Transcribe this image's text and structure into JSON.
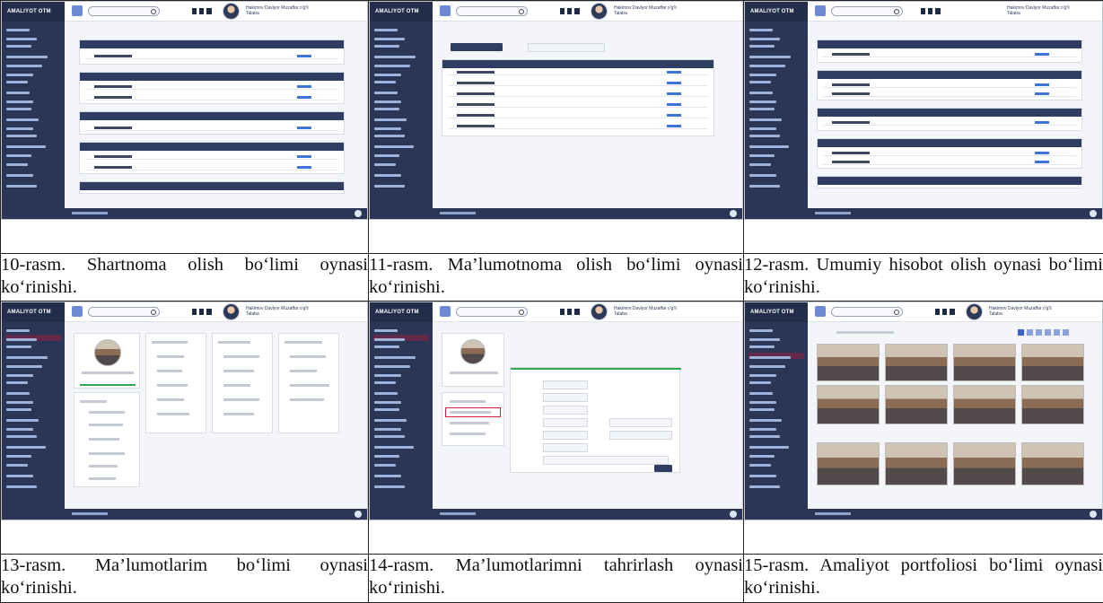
{
  "shared": {
    "brand": "AMALIYOT OTM",
    "user_name_line1": "Hakimov Davlyor Muzaffar o'g'li",
    "user_name_line2": "Talaba"
  },
  "captions": [
    {
      "title": "10-rasm.",
      "text": "Shartnoma olish bo‘limi oynasi ko‘rinishi."
    },
    {
      "title": "11-rasm.",
      "text": "Ma’lumotnoma olish bo‘limi oynasi ko‘rinishi."
    },
    {
      "title": "12-rasm.",
      "text": "Umumiy hisobot olish oynasi bo‘limi ko‘rinishi."
    },
    {
      "title": "13-rasm.",
      "text": "Ma’lumotlarim bo‘limi oynasi ko‘rinishi."
    },
    {
      "title": "14-rasm.",
      "text": "Ma’lumotlarimni tahrirlash oynasi ko‘rinishi."
    },
    {
      "title": "15-rasm.",
      "text": "Amaliyot portfoliosi bo‘limi oynasi ko‘rinishi."
    }
  ]
}
